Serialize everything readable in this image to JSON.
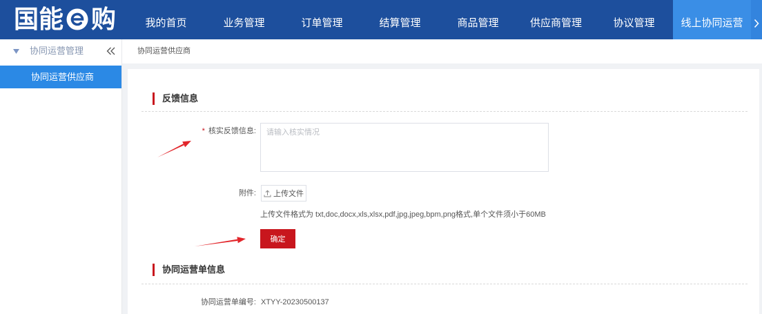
{
  "header": {
    "logo": {
      "left": "国能",
      "right": "购",
      "icon": "e-circle-logo-icon"
    },
    "nav": [
      {
        "label": "我的首页",
        "active": false
      },
      {
        "label": "业务管理",
        "active": false
      },
      {
        "label": "订单管理",
        "active": false
      },
      {
        "label": "结算管理",
        "active": false
      },
      {
        "label": "商品管理",
        "active": false
      },
      {
        "label": "供应商管理",
        "active": false
      },
      {
        "label": "协议管理",
        "active": false
      },
      {
        "label": "线上协同运营",
        "active": true
      }
    ],
    "more_icon": "chevron-right-icon"
  },
  "sidebar": {
    "group_icon": "caret-down-icon",
    "group_label": "协同运营管理",
    "collapse_icon": "double-chevron-left-icon",
    "items": [
      {
        "label": "协同运营供应商",
        "active": true
      }
    ]
  },
  "breadcrumb": {
    "current": "协同运营供应商"
  },
  "feedback_section": {
    "title": "反馈信息",
    "verify_field": {
      "required_mark": "*",
      "label": "核实反馈信息:",
      "placeholder": "请输入核实情况",
      "value": ""
    },
    "attachment": {
      "label": "附件:",
      "upload_icon": "upload-icon",
      "upload_label": "上传文件",
      "hint": "上传文件格式为 txt,doc,docx,xls,xlsx,pdf,jpg,jpeg,bpm,png格式,单个文件须小于60MB"
    },
    "confirm_label": "确定"
  },
  "order_section": {
    "title": "协同运营单信息",
    "fields": [
      {
        "label": "协同运营单编号:",
        "value": "XTYY-20230500137"
      }
    ]
  },
  "colors": {
    "nav_bg": "#1d4f9d",
    "nav_active_bg": "#3a8ee6",
    "nav_more_bg": "#3384de",
    "sidebar_active_bg": "#2b89e5",
    "accent_red": "#c8161d",
    "page_bg": "#f0f2f5",
    "annotation_red": "#e2262b"
  }
}
